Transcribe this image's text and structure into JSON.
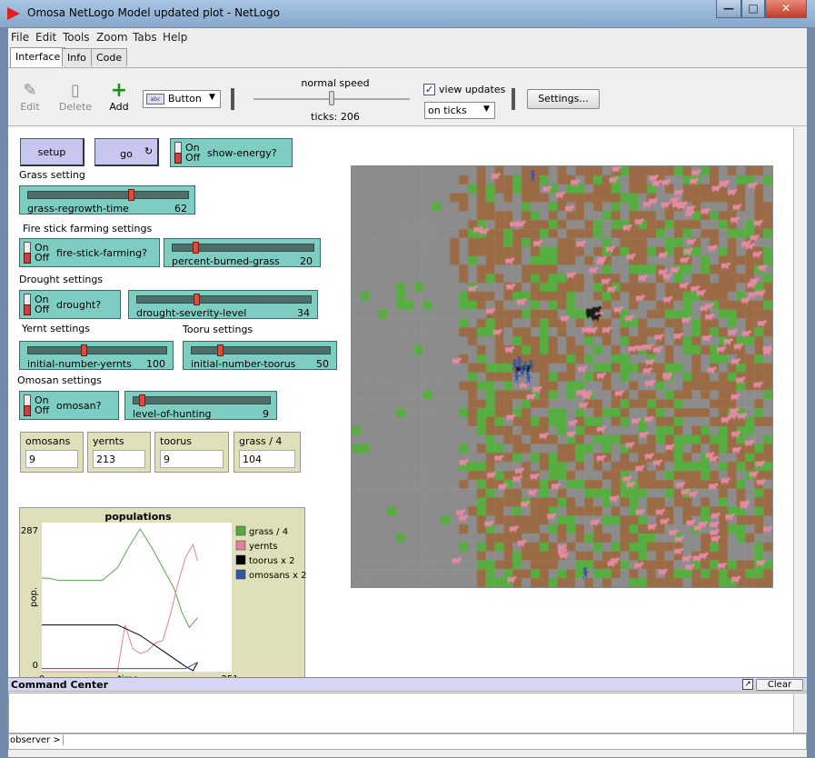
{
  "window": {
    "title": "Omosa NetLogo Model updated plot - NetLogo"
  },
  "menu": [
    "File",
    "Edit",
    "Tools",
    "Zoom",
    "Tabs",
    "Help"
  ],
  "tabs": [
    "Interface",
    "Info",
    "Code"
  ],
  "toolbar": {
    "edit": "Edit",
    "delete": "Delete",
    "add": "Add",
    "widget_type": "Button",
    "speed_label": "normal speed",
    "ticks": "ticks: 206",
    "view_updates": "view updates",
    "update_mode": "on ticks",
    "settings": "Settings..."
  },
  "widgets": {
    "setup": "setup",
    "go": "go",
    "switch_on": "On",
    "switch_off": "Off",
    "show_energy": "show-energy?",
    "grass_setting": "Grass setting",
    "grass_regrowth": {
      "name": "grass-regrowth-time",
      "value": "62",
      "fraction": 0.65
    },
    "fire_settings": "Fire stick farming settings",
    "fire_stick": "fire-stick-farming?",
    "percent_burned": {
      "name": "percent-burned-grass",
      "value": "20",
      "fraction": 0.15
    },
    "drought_settings": "Drought settings",
    "drought": "drought?",
    "drought_severity": {
      "name": "drought-severity-level",
      "value": "34",
      "fraction": 0.34
    },
    "yernt_settings": "Yernt settings",
    "tooru_settings": "Tooru settings",
    "init_yernts": {
      "name": "initial-number-yernts",
      "value": "100",
      "fraction": 0.4
    },
    "init_toorus": {
      "name": "initial-number-toorus",
      "value": "50",
      "fraction": 0.2
    },
    "omosan_settings": "Omosan settings",
    "omosan": "omosan?",
    "hunting": {
      "name": "level-of-hunting",
      "value": "9",
      "fraction": 0.05
    }
  },
  "monitors": [
    {
      "label": "omosans",
      "value": "9"
    },
    {
      "label": "yernts",
      "value": "213"
    },
    {
      "label": "toorus",
      "value": "9"
    },
    {
      "label": "grass / 4",
      "value": "104"
    }
  ],
  "plot": {
    "title": "populations",
    "ylabel": "pop.",
    "xlabel": "time",
    "ymax": "287",
    "ymin": "0",
    "xmin": "0",
    "xmax": "251"
  },
  "chart_data": {
    "type": "line",
    "title": "populations",
    "xlabel": "time",
    "ylabel": "pop.",
    "xlim": [
      0,
      251
    ],
    "ylim": [
      0,
      287
    ],
    "legend_position": "right",
    "series": [
      {
        "name": "grass / 4",
        "color": "#55aa44",
        "x": [
          0,
          10,
          20,
          40,
          60,
          80,
          100,
          115,
          130,
          145,
          160,
          175,
          185,
          195,
          206
        ],
        "y": [
          180,
          180,
          176,
          176,
          176,
          176,
          200,
          240,
          275,
          240,
          200,
          160,
          115,
          85,
          104
        ]
      },
      {
        "name": "yernts",
        "color": "#e57fa0",
        "x": [
          0,
          30,
          60,
          90,
          100,
          110,
          120,
          130,
          140,
          150,
          160,
          170,
          180,
          190,
          200,
          206
        ],
        "y": [
          0,
          0,
          0,
          0,
          0,
          90,
          45,
          35,
          40,
          55,
          60,
          110,
          170,
          220,
          245,
          213
        ]
      },
      {
        "name": "toorus x 2",
        "color": "#000000",
        "x": [
          0,
          20,
          40,
          60,
          80,
          100,
          115,
          130,
          145,
          160,
          175,
          190,
          200,
          206
        ],
        "y": [
          90,
          90,
          90,
          90,
          90,
          90,
          80,
          70,
          55,
          40,
          25,
          10,
          2,
          18
        ]
      },
      {
        "name": "omosans x 2",
        "color": "#3355aa",
        "x": [
          0,
          50,
          100,
          150,
          190,
          206
        ],
        "y": [
          6,
          6,
          6,
          6,
          6,
          18
        ]
      }
    ]
  },
  "command_center": {
    "title": "Command Center",
    "clear": "Clear",
    "prompt": "observer >"
  },
  "world": {
    "grid": 47,
    "colors": {
      "gray": "#8c8c8c",
      "brown": "#9b6b45",
      "green": "#56ad40",
      "pink": "#e58aa5",
      "blue": "#3a55aa",
      "black": "#1a1a1a"
    },
    "omosans_shown": 9,
    "toorus_shown": 9,
    "yernts_shown": 213
  }
}
